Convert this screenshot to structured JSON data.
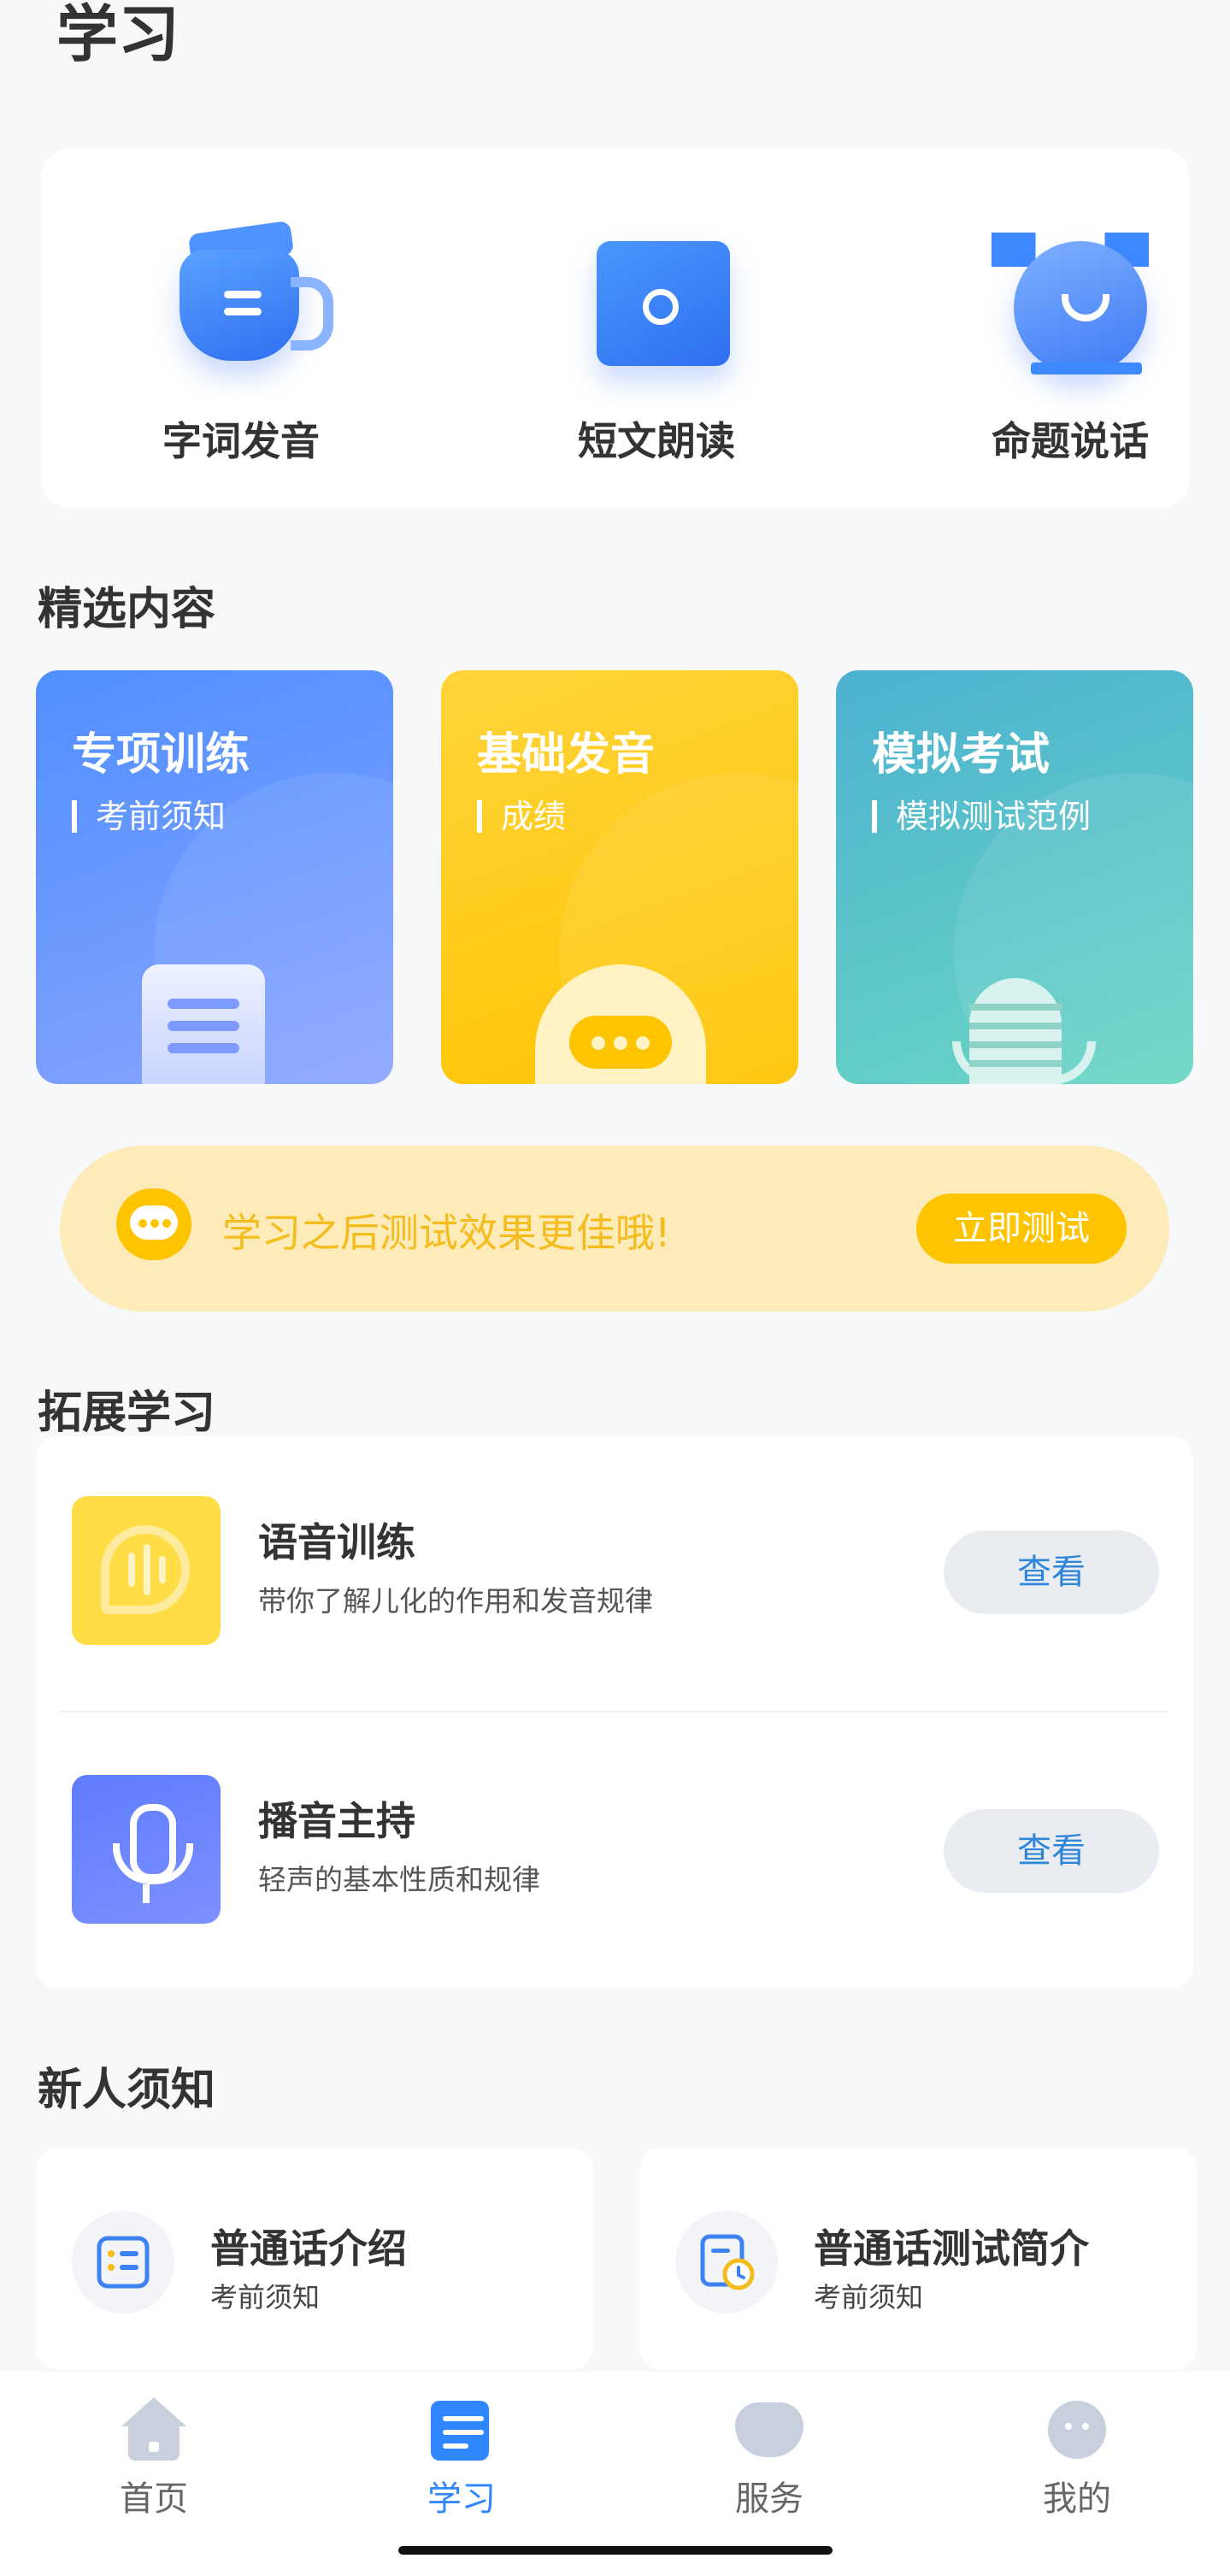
{
  "page": {
    "title": "学习"
  },
  "entries": [
    {
      "label": "字词发音",
      "icon": "cup-icon"
    },
    {
      "label": "短文朗读",
      "icon": "book-icon"
    },
    {
      "label": "命题说话",
      "icon": "speaking-face-icon"
    }
  ],
  "featured": {
    "title": "精选内容",
    "cards": [
      {
        "title": "专项训练",
        "subtitle": "考前须知",
        "icon": "document-icon",
        "color": "#4f8fff"
      },
      {
        "title": "基础发音",
        "subtitle": "成绩",
        "icon": "robot-icon",
        "color": "#ffc400"
      },
      {
        "title": "模拟考试",
        "subtitle": "模拟测试范例",
        "icon": "microphone-icon",
        "color": "#4db1d1"
      }
    ]
  },
  "banner": {
    "text": "学习之后测试效果更佳哦!",
    "button": "立即测试",
    "icon": "chat-bot-icon"
  },
  "extended": {
    "title": "拓展学习",
    "items": [
      {
        "title": "语音训练",
        "subtitle": "带你了解儿化的作用和发音规律",
        "button": "查看",
        "icon": "voice-wave-icon"
      },
      {
        "title": "播音主持",
        "subtitle": "轻声的基本性质和规律",
        "button": "查看",
        "icon": "microphone-icon"
      }
    ]
  },
  "newcomer": {
    "title": "新人须知",
    "items": [
      {
        "title": "普通话介绍",
        "subtitle": "考前须知",
        "icon": "list-doc-icon"
      },
      {
        "title": "普通话测试简介",
        "subtitle": "考前须知",
        "icon": "clock-doc-icon"
      }
    ]
  },
  "tabbar": {
    "active": "学习",
    "tabs": [
      {
        "label": "首页",
        "icon": "home-icon"
      },
      {
        "label": "学习",
        "icon": "study-icon"
      },
      {
        "label": "服务",
        "icon": "heart-icon"
      },
      {
        "label": "我的",
        "icon": "profile-icon"
      }
    ]
  },
  "colors": {
    "accent": "#2f86ff",
    "banner_bg": "#fdebb9",
    "banner_text": "#f4bc1c",
    "button_yellow": "#ffc400"
  }
}
